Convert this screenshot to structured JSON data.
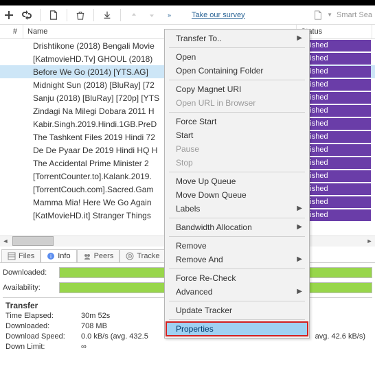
{
  "toolbar": {
    "survey_link": "Take our survey",
    "smart_search": "Smart Sea"
  },
  "columns": {
    "num": "#",
    "name": "Name",
    "status": "Status"
  },
  "status_finished": "Finished",
  "torrents": [
    {
      "name": "Drishtikone (2018) Bengali Movie"
    },
    {
      "name": "[KatmovieHD.Tv] GHOUL (2018)"
    },
    {
      "name": "Before We Go (2014) [YTS.AG]"
    },
    {
      "name": "Midnight Sun (2018) [BluRay] [72"
    },
    {
      "name": "Sanju (2018) [BluRay] [720p] [YTS"
    },
    {
      "name": "Zindagi Na Milegi Dobara 2011 H"
    },
    {
      "name": "Kabir.Singh.2019.Hindi.1GB.PreD"
    },
    {
      "name": "The Tashkent Files 2019 Hindi 72"
    },
    {
      "name": "De De Pyaar De 2019 Hindi HQ H"
    },
    {
      "name": "The Accidental Prime Minister 2"
    },
    {
      "name": "[TorrentCounter.to].Kalank.2019."
    },
    {
      "name": "[TorrentCouch.com].Sacred.Gam"
    },
    {
      "name": "Mamma Mia! Here We Go Again"
    },
    {
      "name": "[KatMovieHD.it] Stranger Things"
    }
  ],
  "selected_index": 2,
  "context_menu": [
    {
      "label": "Transfer To..",
      "kind": "submenu"
    },
    {
      "kind": "sep"
    },
    {
      "label": "Open",
      "kind": "item"
    },
    {
      "label": "Open Containing Folder",
      "kind": "item"
    },
    {
      "kind": "sep"
    },
    {
      "label": "Copy Magnet URI",
      "kind": "item"
    },
    {
      "label": "Open URL in Browser",
      "kind": "disabled"
    },
    {
      "kind": "sep"
    },
    {
      "label": "Force Start",
      "kind": "item"
    },
    {
      "label": "Start",
      "kind": "item"
    },
    {
      "label": "Pause",
      "kind": "disabled"
    },
    {
      "label": "Stop",
      "kind": "disabled"
    },
    {
      "kind": "sep"
    },
    {
      "label": "Move Up Queue",
      "kind": "item"
    },
    {
      "label": "Move Down Queue",
      "kind": "item"
    },
    {
      "label": "Labels",
      "kind": "submenu"
    },
    {
      "kind": "sep"
    },
    {
      "label": "Bandwidth Allocation",
      "kind": "submenu"
    },
    {
      "kind": "sep"
    },
    {
      "label": "Remove",
      "kind": "item"
    },
    {
      "label": "Remove And",
      "kind": "submenu"
    },
    {
      "kind": "sep"
    },
    {
      "label": "Force Re-Check",
      "kind": "item"
    },
    {
      "label": "Advanced",
      "kind": "submenu"
    },
    {
      "kind": "sep"
    },
    {
      "label": "Update Tracker",
      "kind": "item"
    },
    {
      "kind": "sep"
    },
    {
      "label": "Properties",
      "kind": "highlight"
    }
  ],
  "tabs": {
    "files": "Files",
    "info": "Info",
    "peers": "Peers",
    "trackers": "Tracke"
  },
  "detail": {
    "downloaded_label": "Downloaded:",
    "downloaded_pct": 100,
    "availability_label": "Availability:",
    "availability_pct": 100,
    "transfer_head": "Transfer",
    "time_elapsed_label": "Time Elapsed:",
    "time_elapsed_value": "30m 52s",
    "downloaded_size_label": "Downloaded:",
    "downloaded_size_value": "708 MB",
    "dl_speed_label": "Download Speed:",
    "dl_speed_value": "0.0 kB/s (avg. 432.5",
    "down_limit_label": "Down Limit:",
    "down_limit_value": "∞",
    "avg_extra": "avg. 42.6 kB/s)"
  }
}
